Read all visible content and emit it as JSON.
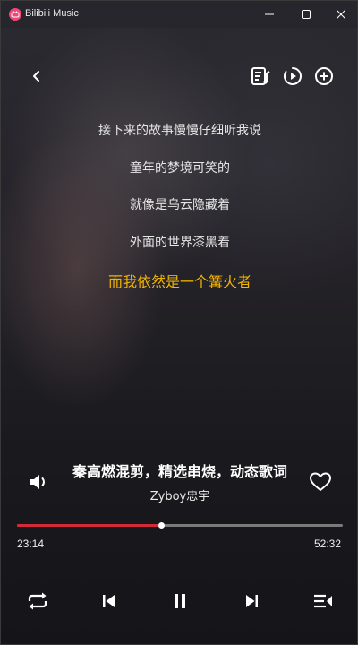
{
  "window": {
    "title": "Bilibili Music",
    "app_icon": "bilibili-music-logo",
    "controls": [
      "minimize-icon",
      "maximize-icon",
      "close-icon"
    ]
  },
  "header": {
    "back_icon": "chevron-left-icon",
    "actions": [
      "lyrics-list-icon",
      "play-circle-icon",
      "add-circle-icon"
    ]
  },
  "lyrics": [
    {
      "text": "接下来的故事慢慢仔细听我说",
      "current": false
    },
    {
      "text": "童年的梦境可笑的",
      "current": false
    },
    {
      "text": "就像是乌云隐藏着",
      "current": false
    },
    {
      "text": "外面的世界漆黑着",
      "current": false
    },
    {
      "text": "而我依然是一个篝火者",
      "current": true
    }
  ],
  "song": {
    "title": "秦高燃混剪，精选串烧，动态歌词",
    "artist": "Zyboy忠宇"
  },
  "playback": {
    "current_time": "23:14",
    "total_time": "52:32",
    "progress": 0.443
  },
  "controls": [
    "repeat-icon",
    "previous-icon",
    "pause-icon",
    "next-icon",
    "playlist-icon"
  ],
  "colors": {
    "accent": "#d02b36",
    "current_lyric": "#f2b400",
    "app_icon": "#f0467a"
  }
}
